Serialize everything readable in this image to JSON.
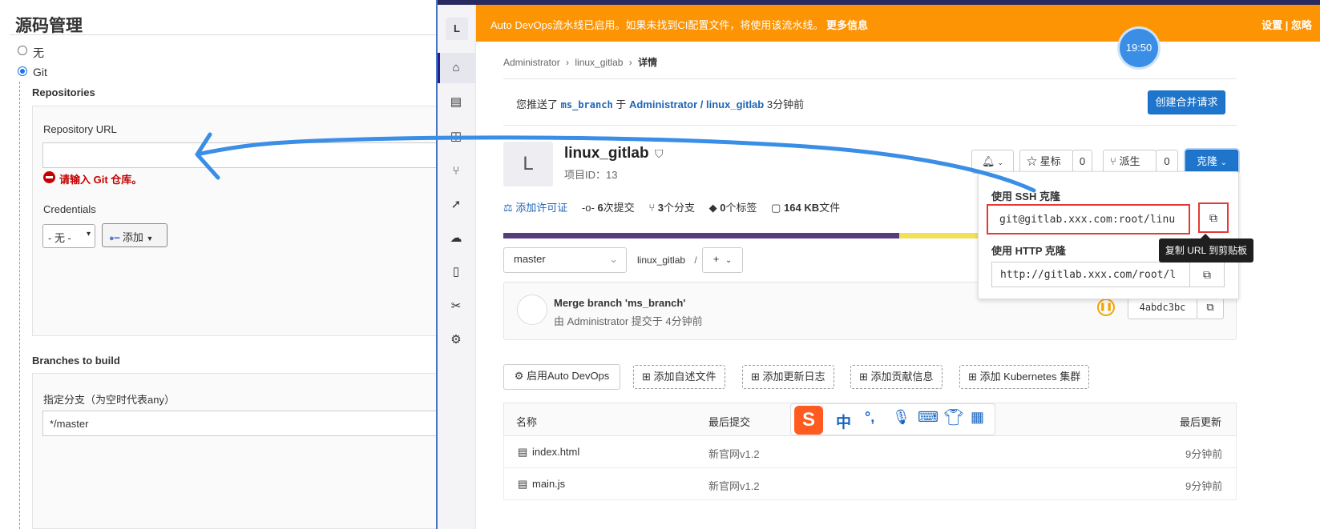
{
  "jenkins": {
    "section_title": "源码管理",
    "scm_options": [
      "无",
      "Git"
    ],
    "repositories_label": "Repositories",
    "repo_url_label": "Repository URL",
    "repo_url_value": "",
    "repo_error": "请输入 Git 仓库。",
    "credentials_label": "Credentials",
    "credentials_select": "- 无 -",
    "add_button": "添加",
    "branches_label": "Branches to build",
    "branch_spec_label": "指定分支（为空时代表any）",
    "branch_spec_value": "*/master"
  },
  "gitlab": {
    "rail_avatar": "L",
    "banner": {
      "text": "Auto DevOps流水线已启用。如果未找到CI配置文件，将使用该流水线。",
      "more": "更多信息",
      "settings": "设置",
      "divider": "|",
      "dismiss": "忽略"
    },
    "clock": "19:50",
    "breadcrumb": [
      "Administrator",
      "linux_gitlab",
      "详情"
    ],
    "push_notice": {
      "prefix": "您推送了",
      "branch": "ms_branch",
      "mid": "于",
      "project": "Administrator / linux_gitlab",
      "time": "3分钟前",
      "button": "创建合并请求"
    },
    "project": {
      "avatar": "L",
      "name": "linux_gitlab",
      "id_label": "项目ID：13"
    },
    "actions": {
      "star_label": "星标",
      "star_count": "0",
      "fork_label": "派生",
      "fork_count": "0",
      "clone_label": "克隆"
    },
    "stats": {
      "license": "添加许可证",
      "commits_n": "6",
      "commits": "次提交",
      "branches_n": "3",
      "branches": "个分支",
      "tags_n": "0",
      "tags": "个标签",
      "size_n": "164 KB",
      "size": "文件"
    },
    "branch_select": "master",
    "path": "linux_gitlab",
    "path_sep": "/",
    "add_label": "+",
    "commit": {
      "title": "Merge branch 'ms_branch'",
      "meta": "由 Administrator 提交于 4分钟前",
      "sha": "4abdc3bc"
    },
    "clone_panel": {
      "ssh_label": "使用 SSH 克隆",
      "ssh_url": "git@gitlab.xxx.com:root/linu",
      "http_label": "使用 HTTP 克隆",
      "http_url": "http://gitlab.xxx.com/root/l",
      "tooltip": "复制 URL 到剪贴板"
    },
    "quick_actions": [
      "启用Auto DevOps",
      "添加自述文件",
      "添加更新日志",
      "添加贡献信息",
      "添加 Kubernetes 集群"
    ],
    "table": {
      "col_name": "名称",
      "col_commit": "最后提交",
      "col_updated": "最后更新",
      "rows": [
        {
          "name": "index.html",
          "commit": "新官网v1.2",
          "updated": "9分钟前"
        },
        {
          "name": "main.js",
          "commit": "新官网v1.2",
          "updated": "9分钟前"
        }
      ]
    },
    "ime": {
      "logo": "S",
      "lang": "中",
      "punct": "°,"
    }
  },
  "colors": {
    "banner": "#fc9403",
    "primary": "#1f75cb",
    "arrow": "#3a8ee6",
    "error": "#c40000",
    "highlight": "#e53935"
  }
}
